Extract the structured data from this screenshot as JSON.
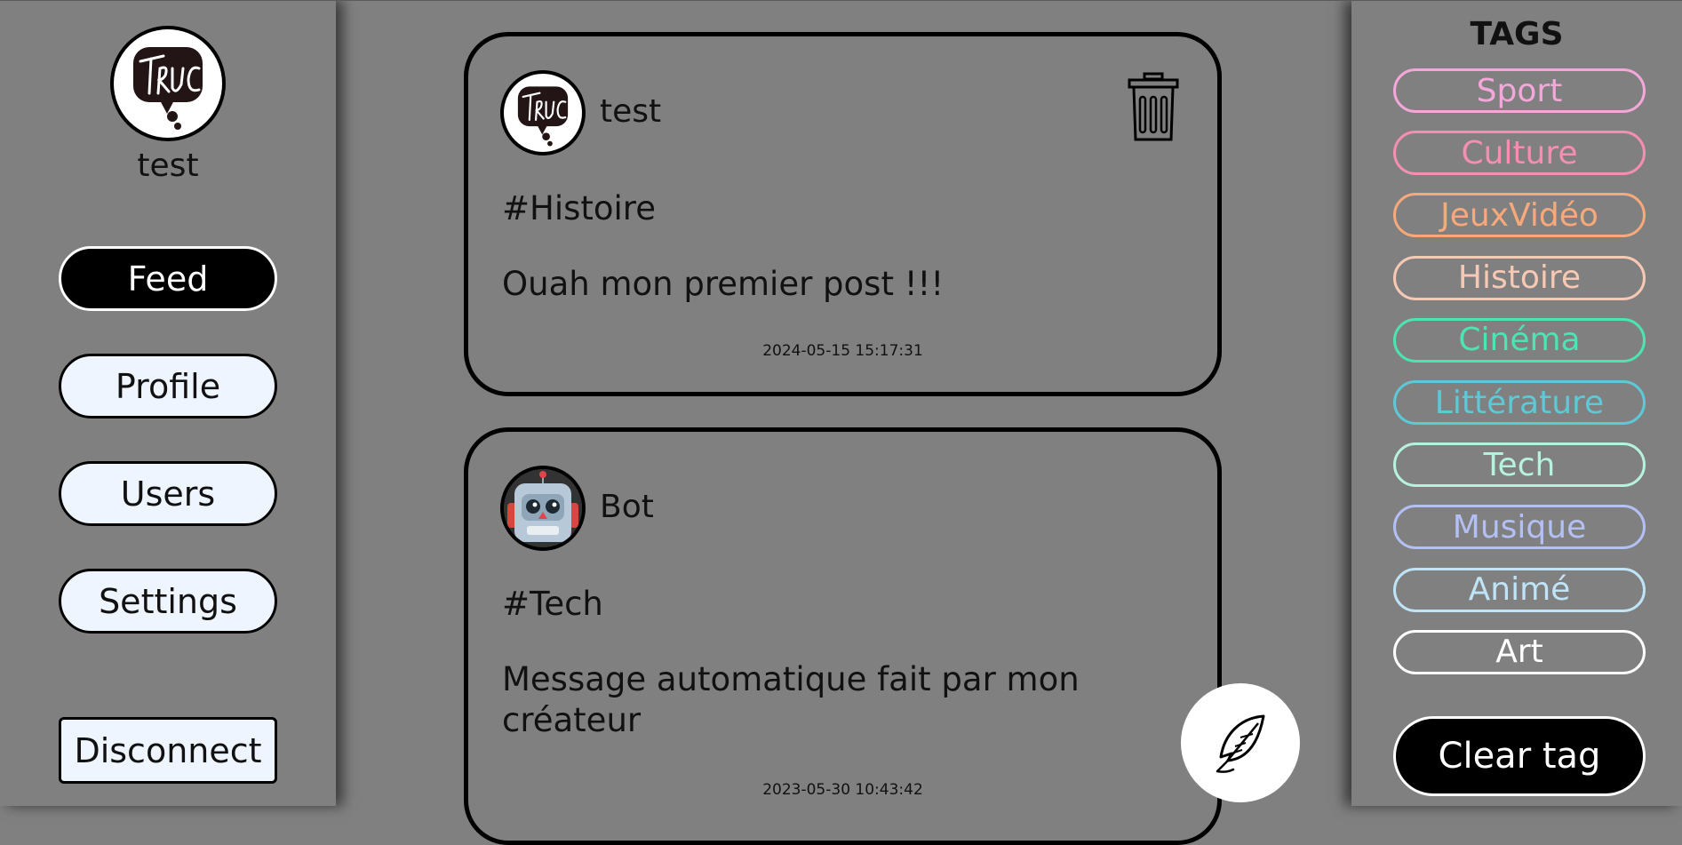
{
  "user": {
    "name": "test"
  },
  "nav": {
    "feed": "Feed",
    "profile": "Profile",
    "users": "Users",
    "settings": "Settings",
    "disconnect": "Disconnect"
  },
  "posts": [
    {
      "author": "test",
      "tag": "#Histoire",
      "body": "Ouah mon premier post !!!",
      "date": "2024-05-15 15:17:31"
    },
    {
      "author": "Bot",
      "tag": "#Tech",
      "body": "Message automatique fait par mon créateur",
      "date": "2023-05-30 10:43:42"
    }
  ],
  "tags": {
    "title": "TAGS",
    "items": [
      {
        "label": "Sport",
        "color": "#f4a7d9"
      },
      {
        "label": "Culture",
        "color": "#f58fb0"
      },
      {
        "label": "JeuxVidéo",
        "color": "#f7a97c"
      },
      {
        "label": "Histoire",
        "color": "#f7c8b4"
      },
      {
        "label": "Cinéma",
        "color": "#4de3b3"
      },
      {
        "label": "Littérature",
        "color": "#5ec9d6"
      },
      {
        "label": "Tech",
        "color": "#b6f2de"
      },
      {
        "label": "Musique",
        "color": "#b3c0f5"
      },
      {
        "label": "Animé",
        "color": "#bfe3f7"
      },
      {
        "label": "Art",
        "color": "#ffffff"
      }
    ],
    "clear": "Clear tag"
  },
  "icons": {
    "logo": "truc-logo-icon",
    "trash": "trash-icon",
    "new_post": "feather-icon",
    "bot_avatar": "robot-icon"
  },
  "colors": {
    "background": "#808080",
    "active_nav": "#000000",
    "nav_button": "#eef5ff"
  }
}
